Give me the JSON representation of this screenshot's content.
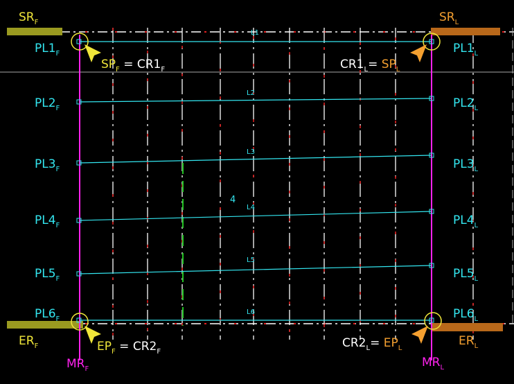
{
  "colors": {
    "background": "#000000",
    "cyan": "#33e6f0",
    "magenta": "#ff22ee",
    "yellow": "#f0e63a",
    "orange": "#f5a030",
    "white": "#ffffff",
    "red_dash": "#e02020",
    "green_dash": "#22c022",
    "grey_line": "#a8a8a8",
    "olive_bar": "#9a9a20",
    "orange_bar": "#b8681a"
  },
  "labels": {
    "sr_first": {
      "main": "SR",
      "sub": "F"
    },
    "sr_last": {
      "main": "SR",
      "sub": "L"
    },
    "er_first": {
      "main": "ER",
      "sub": "F"
    },
    "er_last": {
      "main": "ER",
      "sub": "L"
    },
    "mr_first": {
      "main": "MR",
      "sub": "F"
    },
    "mr_last": {
      "main": "MR",
      "sub": "L"
    },
    "sp_first": {
      "main": "SP",
      "sub": "F",
      "eq": " = ",
      "rhs_main": "CR1",
      "rhs_sub": "F"
    },
    "cr1_last": {
      "lhs_main": "CR1",
      "lhs_sub": "L",
      "eq": "= ",
      "main": "SP",
      "sub": "L"
    },
    "ep_first": {
      "main": "EP",
      "sub": "F",
      "eq": " = ",
      "rhs_main": "CR2",
      "rhs_sub": "F"
    },
    "cr2_last": {
      "lhs_main": "CR2",
      "lhs_sub": "L",
      "eq": "= ",
      "main": "EP",
      "sub": "L"
    }
  },
  "panel_lines": [
    {
      "name": "PL1",
      "first_sub": "F",
      "last_sub": "L",
      "line_label": "L1"
    },
    {
      "name": "PL2",
      "first_sub": "F",
      "last_sub": "L",
      "line_label": "L2"
    },
    {
      "name": "PL3",
      "first_sub": "F",
      "last_sub": "L",
      "line_label": "L3"
    },
    {
      "name": "PL4",
      "first_sub": "F",
      "last_sub": "L",
      "line_label": "L4"
    },
    {
      "name": "PL5",
      "first_sub": "F",
      "last_sub": "L",
      "line_label": "L5"
    },
    {
      "name": "PL6",
      "first_sub": "F",
      "last_sub": "L",
      "line_label": "L6"
    }
  ],
  "misc": {
    "center_marker": "4"
  }
}
